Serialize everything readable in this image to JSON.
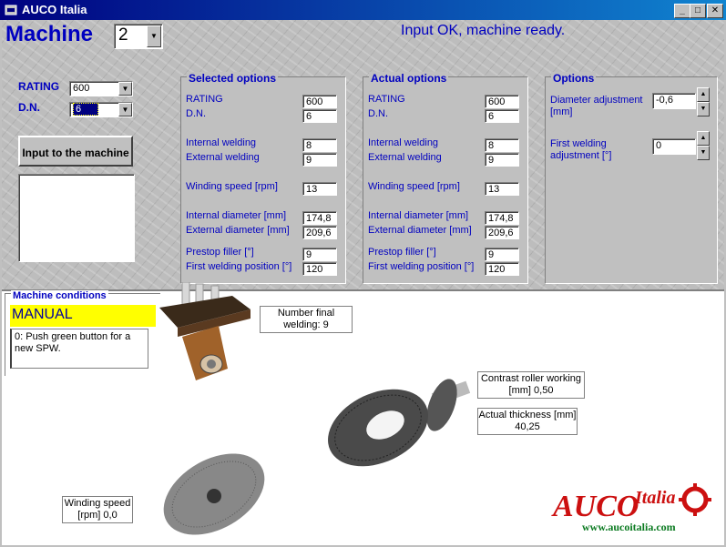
{
  "window": {
    "title": "AUCO Italia"
  },
  "header": {
    "machine_label": "Machine",
    "machine_value": "2",
    "status": "Input OK, machine ready."
  },
  "left": {
    "rating_label": "RATING",
    "rating_value": "600",
    "dn_label": "D.N.",
    "dn_value": "6",
    "input_button": "Input to the machine"
  },
  "selected_options": {
    "title": "Selected options",
    "rows": [
      {
        "label": "RATING",
        "value": "600"
      },
      {
        "label": "D.N.",
        "value": "6"
      },
      {
        "label": "Internal welding",
        "value": "8"
      },
      {
        "label": "External welding",
        "value": "9"
      },
      {
        "label": "Winding speed [rpm]",
        "value": "13"
      },
      {
        "label": "Internal diameter [mm]",
        "value": "174,8"
      },
      {
        "label": "External diameter [mm]",
        "value": "209,6"
      },
      {
        "label": "Prestop filler [°]",
        "value": "9"
      },
      {
        "label": "First welding position [°]",
        "value": "120"
      }
    ]
  },
  "actual_options": {
    "title": "Actual options",
    "rows": [
      {
        "label": "RATING",
        "value": "600"
      },
      {
        "label": "D.N.",
        "value": "6"
      },
      {
        "label": "Internal welding",
        "value": "8"
      },
      {
        "label": "External welding",
        "value": "9"
      },
      {
        "label": "Winding speed [rpm]",
        "value": "13"
      },
      {
        "label": "Internal diameter [mm]",
        "value": "174,8"
      },
      {
        "label": "External diameter [mm]",
        "value": "209,6"
      },
      {
        "label": "Prestop filler [°]",
        "value": "9"
      },
      {
        "label": "First welding position [°]",
        "value": "120"
      }
    ]
  },
  "options": {
    "title": "Options",
    "diameter_label_1": "Diameter adjustment",
    "diameter_label_2": "[mm]",
    "diameter_value": "-0,6",
    "first_welding_label_1": "First welding",
    "first_welding_label_2": "adjustment [°]",
    "first_welding_value": "0"
  },
  "conditions": {
    "title": "Machine conditions",
    "mode": "MANUAL",
    "message": "0: Push green button for a new SPW.",
    "number_final_welding_1": "Number final",
    "number_final_welding_2": "welding: 9",
    "contrast_roller_1": "Contrast roller working",
    "contrast_roller_2": "[mm] 0,50",
    "actual_thickness_1": "Actual thickness [mm]",
    "actual_thickness_2": "40,25",
    "winding_speed_1": "Winding speed",
    "winding_speed_2": "[rpm] 0,0"
  },
  "logo": {
    "brand": "AUCO Italia",
    "url": "www.aucoitalia.com"
  },
  "colors": {
    "title_blue": "#000080",
    "label_blue": "#0000c0",
    "manual_bg": "#ffff00",
    "logo_red": "#cc1010",
    "logo_green": "#0a7a20"
  }
}
